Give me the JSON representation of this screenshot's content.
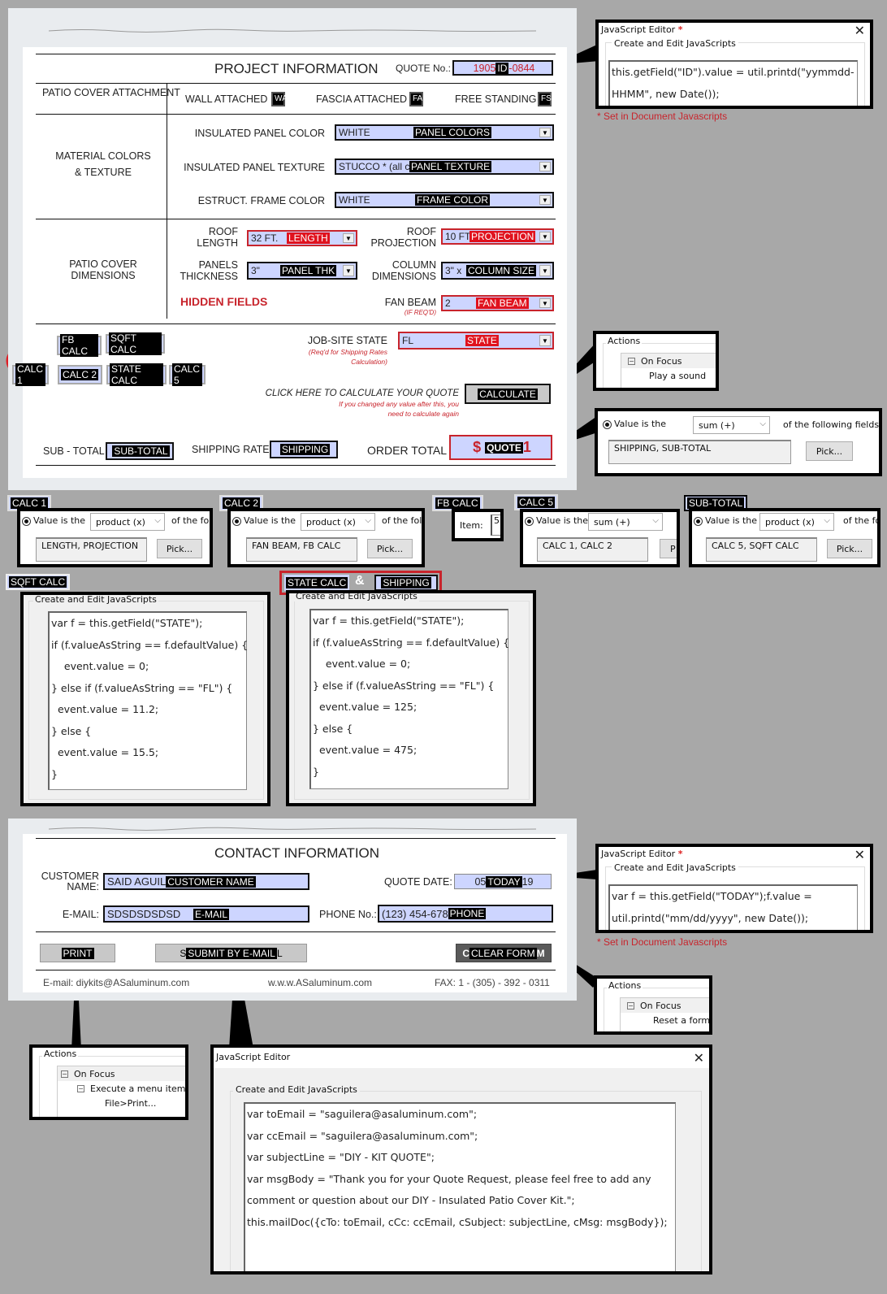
{
  "project": {
    "title": "PROJECT INFORMATION",
    "quote_no_label": "QUOTE No.:",
    "quote_no_prefix": "1905",
    "quote_no_tag": "ID",
    "quote_no_suffix": "-0844",
    "attachment": {
      "section_label": "PATIO COVER ATTACHMENT",
      "options": [
        {
          "label": "WALL ATTACHED",
          "tag": "WA"
        },
        {
          "label": "FASCIA ATTACHED",
          "tag": "FA"
        },
        {
          "label": "FREE STANDING",
          "tag": "FS"
        }
      ]
    },
    "materials": {
      "section_label_1": "MATERIAL  COLORS",
      "section_label_2": "& TEXTURE",
      "rows": [
        {
          "label": "INSULATED PANEL COLOR",
          "value": "WHITE",
          "tag": "PANEL COLORS"
        },
        {
          "label": "INSULATED PANEL TEXTURE",
          "value": "STUCCO * (all c",
          "tag": "PANEL TEXTURE"
        },
        {
          "label": "ESTRUCT. FRAME COLOR",
          "value": "WHITE",
          "tag": "FRAME COLOR"
        }
      ]
    },
    "dimensions": {
      "section_label_1": "PATIO COVER",
      "section_label_2": "DIMENSIONS",
      "roof_length": {
        "label_1": "ROOF",
        "label_2": "LENGTH",
        "value": "32 FT.",
        "tag": "LENGTH"
      },
      "roof_projection": {
        "label_1": "ROOF",
        "label_2": "PROJECTION",
        "value": "10 FT",
        "tag": "PROJECTION"
      },
      "panel_thickness": {
        "label_1": "PANELS",
        "label_2": "THICKNESS",
        "value": "3\"",
        "tag": "PANEL THK"
      },
      "column_dimensions": {
        "label_1": "COLUMN",
        "label_2": "DIMENSIONS",
        "value": "3\" x",
        "tag": "COLUMN SIZE"
      },
      "fan_beam": {
        "label": "FAN BEAM",
        "sub": "(IF REQ'D)",
        "value": "2",
        "tag": "FAN BEAM"
      },
      "hidden_fields_label": "HIDDEN FIELDS"
    },
    "hidden_fields": [
      "FB CALC",
      "SQFT CALC",
      "CALC 1",
      "CALC 2",
      "STATE CALC",
      "CALC 5"
    ],
    "jobsite": {
      "label": "JOB-SITE STATE",
      "sub_1": "(Req'd for Shipping Rates",
      "sub_2": "Calculation)",
      "value": "FL",
      "tag": "STATE"
    },
    "calculate": {
      "prompt": "CLICK HERE TO CALCULATE YOUR QUOTE",
      "sub_1": "If you changed any value after this, you",
      "sub_2": "need to calculate again",
      "button_tag": "CALCULATE"
    },
    "totals": {
      "subtotal_label": "SUB - TOTAL",
      "subtotal_tag": "SUB-TOTAL",
      "shipping_label": "SHIPPING RATE",
      "shipping_tag": "SHIPPING",
      "order_total_label": "ORDER TOTAL",
      "order_total_prefix": "$",
      "order_total_tag": "QUOTE",
      "order_total_suffix": "1"
    }
  },
  "id_editor": {
    "title": "JavaScript Editor",
    "star": "*",
    "close": "✕",
    "group_label": "Create and Edit JavaScripts",
    "code": [
      "this.getField(\"ID\").value = util.printd(\"yymmdd-",
      "HHMM\", new Date());"
    ],
    "note": "* Set in Document Javascripts"
  },
  "calc_actions": {
    "group_label": "Actions",
    "trigger": "On Focus",
    "action": "Play a sound"
  },
  "quote_calc": {
    "value_is_the": "Value is the",
    "operation": "sum (+)",
    "of_fields": "of the following fields:",
    "fields": "SHIPPING, SUB-TOTAL",
    "pick": "Pick..."
  },
  "field_calcs": [
    {
      "tag": "CALC 1",
      "value_is_the": "Value is the",
      "operation": "product (x)",
      "of_fields": "of the fo",
      "fields": "LENGTH, PROJECTION",
      "pick": "Pick..."
    },
    {
      "tag": "CALC 2",
      "value_is_the": "Value is the",
      "operation": "product (x)",
      "of_fields": "of the fol",
      "fields": "FAN BEAM, FB CALC",
      "pick": "Pick..."
    },
    {
      "tag": "FB CALC",
      "item_label": "Item:",
      "item_value": "5"
    },
    {
      "tag": "CALC 5",
      "value_is_the": "Value is the",
      "operation": "sum (+)",
      "of_fields": "",
      "fields": "CALC 1, CALC 2",
      "pick": "P"
    },
    {
      "tag": "SUB-TOTAL",
      "value_is_the": "Value is the",
      "operation": "product (x)",
      "of_fields": "of the fo",
      "fields": "CALC 5, SQFT CALC",
      "pick": "Pick..."
    }
  ],
  "sqft_script": {
    "tag": "SQFT CALC",
    "group_label": "Create and Edit JavaScripts",
    "code": [
      "var f = this.getField(\"STATE\");",
      "if (f.valueAsString == f.defaultValue) {",
      "    event.value = 0;",
      "} else if (f.valueAsString == \"FL\") {",
      "  event.value = 11.2;",
      "} else {",
      "  event.value = 15.5;",
      "}"
    ]
  },
  "shipping_script": {
    "tag_1": "STATE CALC",
    "ampersand": "&",
    "tag_2": "SHIPPING",
    "group_label": "Create and Edit JavaScripts",
    "code": [
      "var f = this.getField(\"STATE\");",
      "if (f.valueAsString == f.defaultValue) {",
      "    event.value = 0;",
      "} else if (f.valueAsString == \"FL\") {",
      "  event.value = 125;",
      "} else {",
      "  event.value = 475;",
      "}"
    ]
  },
  "contact": {
    "title": "CONTACT INFORMATION",
    "customer_label_1": "CUSTOMER",
    "customer_label_2": "NAME:",
    "customer_value": "SAID AGUIL",
    "customer_tag": "CUSTOMER NAME",
    "quote_date_label": "QUOTE DATE:",
    "quote_date_prefix": "05",
    "quote_date_tag": "TODAY",
    "quote_date_suffix": "19",
    "email_label": "E-MAIL:",
    "email_value": "SDSDSDSDSD",
    "email_tag": "E-MAIL",
    "phone_label": "PHONE No.:",
    "phone_value": "(123) 454-678",
    "phone_tag": "PHONE",
    "print_tag": "PRINT",
    "submit_prefix": "S",
    "submit_tag": "SUBMIT BY E-MAIL",
    "submit_suffix": "L",
    "clear_prefix": "C",
    "clear_tag": "CLEAR FORM",
    "clear_suffix": "M",
    "footer_email": "E-mail: diykits@ASaluminum.com",
    "footer_web": "w.w.w.ASaluminum.com",
    "footer_fax": "FAX: 1 - (305) - 392 - 0311"
  },
  "today_editor": {
    "title": "JavaScript Editor",
    "star": "*",
    "close": "✕",
    "group_label": "Create and Edit JavaScripts",
    "code": [
      "var f = this.getField(\"TODAY\");f.value =",
      "util.printd(\"mm/dd/yyyy\", new Date());"
    ],
    "note": "* Set in Document Javascripts"
  },
  "clear_actions": {
    "group_label": "Actions",
    "trigger": "On Focus",
    "action": "Reset a form"
  },
  "print_actions": {
    "group_label": "Actions",
    "trigger": "On Focus",
    "action": "Execute a menu item",
    "detail": "File>Print..."
  },
  "email_editor": {
    "title": "JavaScript Editor",
    "close": "✕",
    "group_label": "Create and Edit JavaScripts",
    "code": [
      "var toEmail = \"saguilera@asaluminum.com\";",
      "var ccEmail = \"saguilera@asaluminum.com\";",
      "var subjectLine = \"DIY - KIT QUOTE\";",
      "var msgBody = \"Thank you for your Quote Request, please feel free to add any",
      "comment or question about our DIY - Insulated Patio Cover Kit.\";",
      "this.mailDoc({cTo: toEmail, cCc: ccEmail, cSubject: subjectLine, cMsg: msgBody});"
    ]
  },
  "colors": {
    "field_fill": "#cdd5ff",
    "accent_red": "#c8242c",
    "background": "#a8a8a8"
  }
}
